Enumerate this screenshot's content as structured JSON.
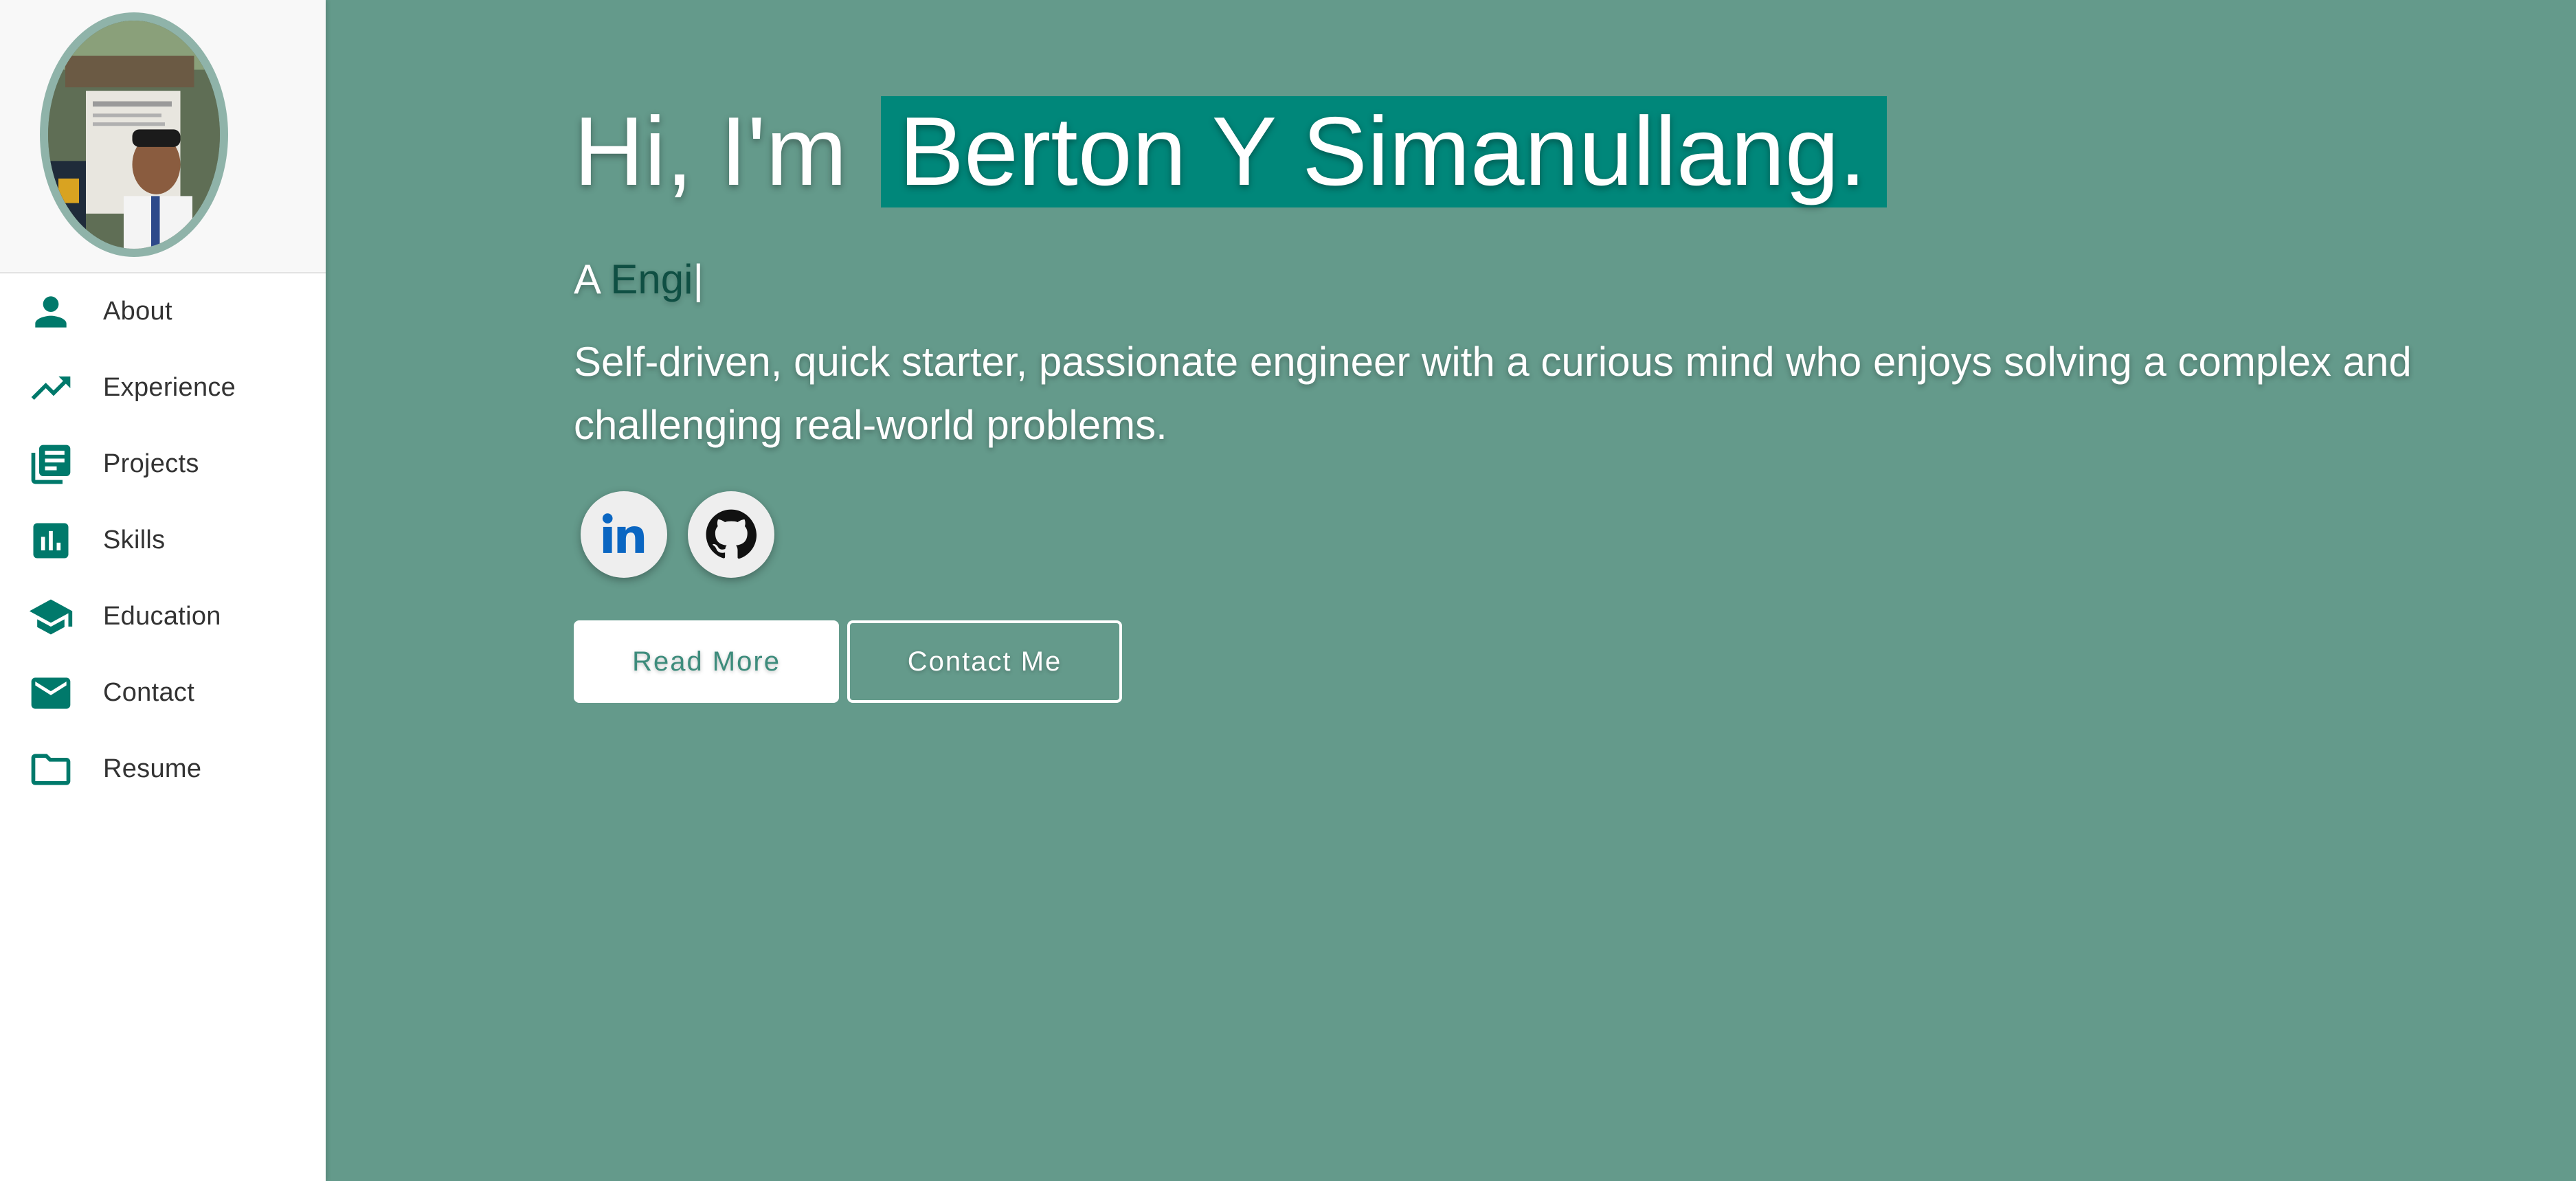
{
  "sidebar": {
    "items": [
      {
        "label": "About",
        "icon": "person-icon"
      },
      {
        "label": "Experience",
        "icon": "trending-up-icon"
      },
      {
        "label": "Projects",
        "icon": "library-books-icon"
      },
      {
        "label": "Skills",
        "icon": "bar-chart-icon"
      },
      {
        "label": "Education",
        "icon": "graduation-cap-icon"
      },
      {
        "label": "Contact",
        "icon": "mail-icon"
      },
      {
        "label": "Resume",
        "icon": "folder-icon"
      }
    ]
  },
  "hero": {
    "greeting_prefix": "Hi, I'm",
    "name": "Berton Y Simanullang.",
    "typed_prefix": "A",
    "typed_word": "Engi",
    "typed_cursor": "|",
    "bio": "Self-driven, quick starter, passionate engineer with a curious mind who enjoys solving a complex and challenging real-world problems.",
    "socials": [
      {
        "icon": "linkedin-icon"
      },
      {
        "icon": "github-icon"
      }
    ],
    "read_more_label": "Read More",
    "contact_label": "Contact Me"
  },
  "colors": {
    "accent": "#00796b",
    "background": "#649a8b",
    "name_highlight": "#00877a"
  }
}
